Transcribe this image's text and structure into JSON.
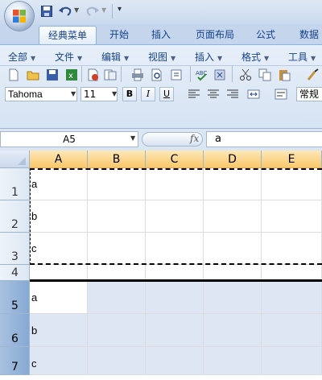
{
  "quick_access": {
    "save_icon": "save-icon",
    "undo_icon": "undo-icon",
    "redo_icon": "redo-icon",
    "customize": "▾"
  },
  "tabs": [
    {
      "label": "经典菜单",
      "active": true
    },
    {
      "label": "开始",
      "active": false
    },
    {
      "label": "插入",
      "active": false
    },
    {
      "label": "页面布局",
      "active": false
    },
    {
      "label": "公式",
      "active": false
    },
    {
      "label": "数据",
      "active": false
    }
  ],
  "classic_menu": [
    "全部",
    "文件",
    "编辑",
    "视图",
    "插入",
    "格式",
    "工具"
  ],
  "font": {
    "name": "Tahoma",
    "size": "11"
  },
  "format_buttons": {
    "bold": "B",
    "italic": "I",
    "underline": "U"
  },
  "number_format": "常规",
  "formula_bar": {
    "name_box": "A5",
    "fx_label": "fx",
    "content": "a"
  },
  "columns": [
    "A",
    "B",
    "C",
    "D",
    "E"
  ],
  "rows": [
    {
      "num": "1",
      "a": "a"
    },
    {
      "num": "2",
      "a": "b"
    },
    {
      "num": "3",
      "a": "c"
    },
    {
      "num": "4",
      "a": ""
    },
    {
      "num": "5",
      "a": "a"
    },
    {
      "num": "6",
      "a": "b"
    },
    {
      "num": "7",
      "a": "c"
    }
  ],
  "colors": {
    "accent": "#15428b",
    "selected_header": "#f9c86b",
    "selection_fill": "#dfe6f3"
  }
}
